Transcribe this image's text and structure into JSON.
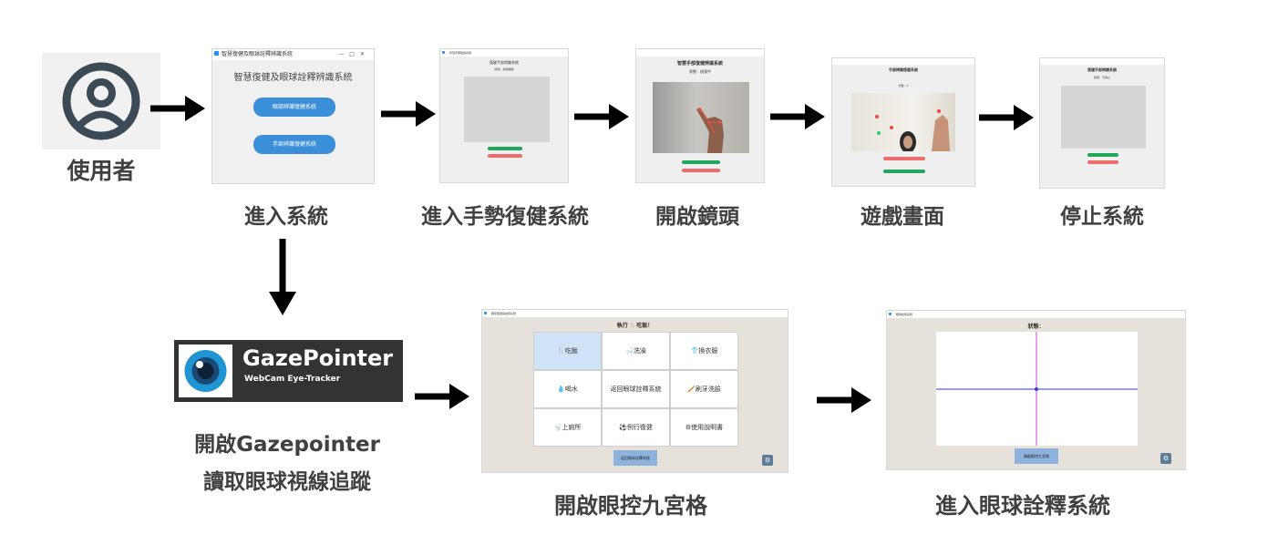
{
  "actors": {
    "user_label": "使用者"
  },
  "steps": {
    "enter_system": "進入系統",
    "enter_gesture": "進入手勢復健系統",
    "open_camera": "開啟鏡頭",
    "game_screen": "遊戲畫面",
    "stop_system": "停止系統",
    "open_gazepointer_line1": "開啟Gazepointer",
    "open_gazepointer_line2": "讀取眼球視線追蹤",
    "open_grid": "開啟眼控九宮格",
    "enter_eye_system": "進入眼球詮釋系統"
  },
  "main_window": {
    "title": "智慧復健及眼球詮釋辨識系統",
    "heading": "智慧復健及眼球詮釋辨識系統",
    "btn_eye": "眼部辨識復健系統",
    "btn_hand": "手部辨識復健系統"
  },
  "gesture_window": {
    "title": "智慧手部復健系統",
    "heading": "復健手部辨識系統",
    "status": "狀態：尚未啟動"
  },
  "camera_window": {
    "heading": "智慧手部復健辨識系統",
    "status": "狀態：偵測中"
  },
  "game_window": {
    "heading": "手部辨識復健系統",
    "score": "分數：0"
  },
  "stop_window": {
    "heading": "復健手部辨識系統",
    "status": "狀態：已停止"
  },
  "gazepointer": {
    "name": "GazePointer",
    "tagline": "WebCam Eye-Tracker"
  },
  "grid_window": {
    "title": "眼控復健與詮釋系統",
    "heading": "執行 🍴吃飯！",
    "cells": [
      "🍴吃飯",
      "🛁洗澡",
      "👕換衣服",
      "💧喝水",
      "返回眼球詮釋系統",
      "🪥刷牙洗臉",
      "🚽上廁所",
      "⚽例行復健",
      "⚙使用說明書"
    ],
    "bottom_btn": "返回眼球詮釋系統"
  },
  "eye_window": {
    "title": "眼球詮釋系統",
    "heading": "狀態：",
    "bottom_btn": "開啟眼控九宮格"
  },
  "colors": {
    "arrow": "#000000",
    "caption": "#404040",
    "blue_btn": "#3b8fd9",
    "gaze_bg": "#333333",
    "eye_blue": "#1f95d3"
  },
  "icons": [
    "user-icon",
    "eye-logo-icon",
    "right-arrow-icon",
    "down-arrow-icon"
  ]
}
